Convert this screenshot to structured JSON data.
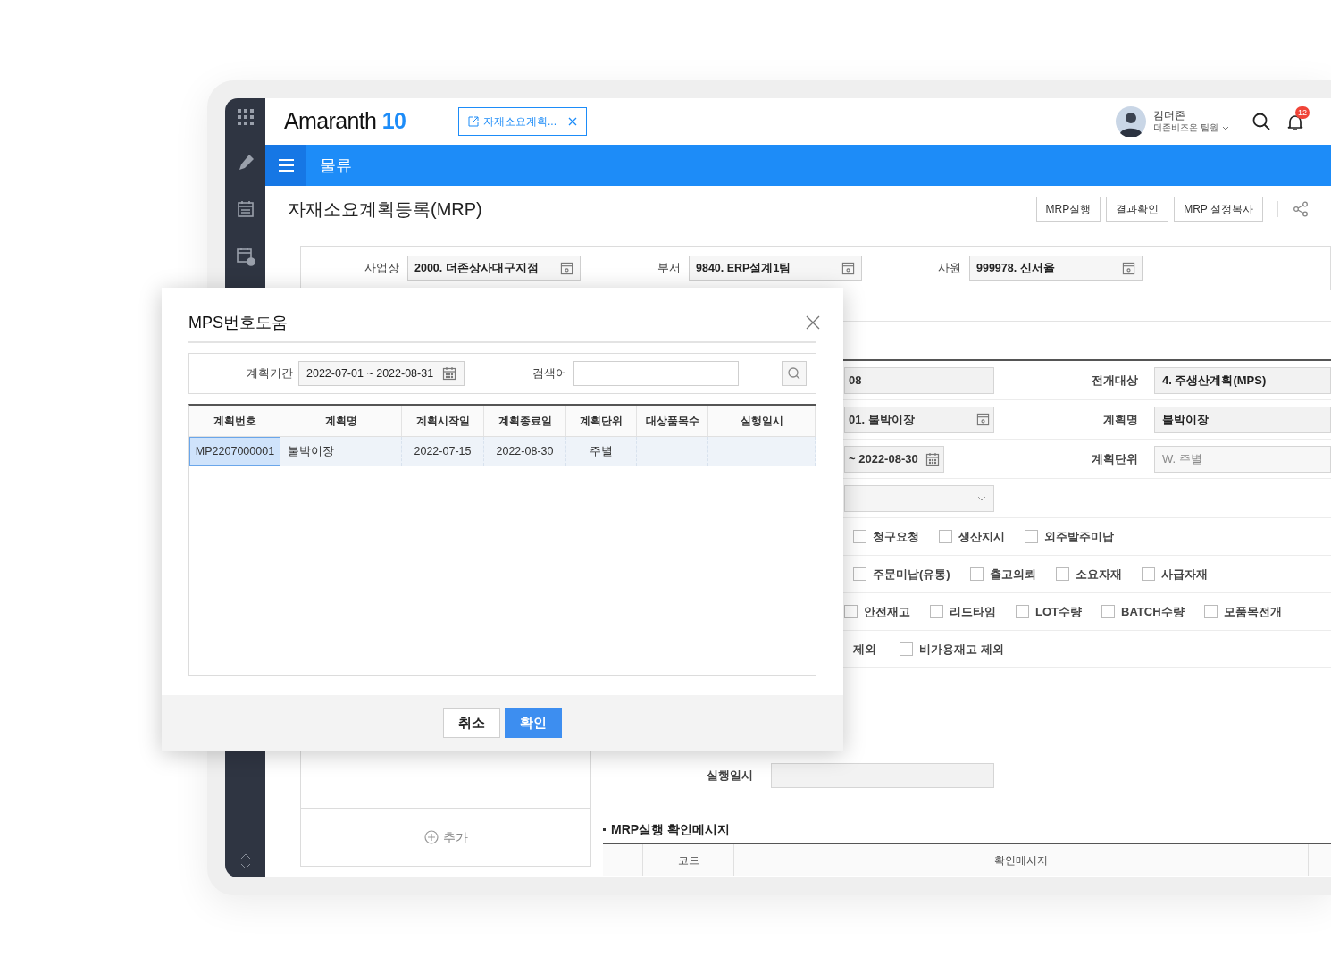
{
  "header": {
    "logo": {
      "name": "Amaranth",
      "version": "10"
    },
    "open_tab": "자재소요계획...",
    "user": {
      "name": "김더존",
      "role": "더존비즈온 팀원"
    },
    "notifications": "12"
  },
  "menu_bar": {
    "title": "물류"
  },
  "page": {
    "title": "자재소요계획등록(MRP)",
    "buttons": [
      "MRP실행",
      "결과확인",
      "MRP 설정복사"
    ]
  },
  "filters": [
    {
      "label": "사업장",
      "value": "2000. 더존상사대구지점"
    },
    {
      "label": "부서",
      "value": "9840. ERP설계1팀"
    },
    {
      "label": "사원",
      "value": "999978. 신서율"
    }
  ],
  "form_rows": [
    {
      "left": {
        "kind": "text",
        "value": "08"
      },
      "label": "전개대상",
      "value": "4. 주생산계획(MPS)",
      "disabled": false
    },
    {
      "left": {
        "kind": "lookup",
        "value": "01. 불박이장"
      },
      "label": "계획명",
      "value": "불박이장",
      "disabled": false
    },
    {
      "left": {
        "kind": "date",
        "value": "~ 2022-08-30"
      },
      "label": "계획단위",
      "value": "W. 주별",
      "disabled": true
    },
    {
      "left": {
        "kind": "select"
      }
    }
  ],
  "options": [
    [
      {
        "kind": "checkbox",
        "label": "청구요청",
        "checked": false
      },
      {
        "kind": "checkbox",
        "label": "생산지시",
        "checked": false
      },
      {
        "kind": "checkbox",
        "label": "외주발주미납",
        "checked": false
      }
    ],
    [
      {
        "kind": "checkbox",
        "label": "주문미납(유통)",
        "checked": false
      },
      {
        "kind": "checkbox",
        "label": "출고의뢰",
        "checked": false
      },
      {
        "kind": "checkbox",
        "label": "소요자재",
        "checked": false
      },
      {
        "kind": "checkbox",
        "label": "사급자재",
        "checked": false
      }
    ],
    [
      {
        "kind": "checkbox",
        "label": "안전재고",
        "checked": false
      },
      {
        "kind": "checkbox",
        "label": "리드타임",
        "checked": false
      },
      {
        "kind": "checkbox",
        "label": "LOT수량",
        "checked": false
      },
      {
        "kind": "checkbox",
        "label": "BATCH수량",
        "checked": false
      },
      {
        "kind": "checkbox",
        "label": "모품목전개",
        "checked": false
      }
    ],
    [
      {
        "kind": "label",
        "label": "제외"
      },
      {
        "kind": "checkbox",
        "label": "비가용재고 제외",
        "checked": false
      }
    ]
  ],
  "run_time": {
    "label": "실행일시"
  },
  "left_panel": {
    "add_button": "추가"
  },
  "messages": {
    "title": "MRP실행 확인메시지",
    "columns": [
      "코드",
      "확인메시지"
    ]
  },
  "dialog": {
    "title": "MPS번호도움",
    "period_label": "계획기간",
    "period": "2022-07-01 ~ 2022-08-31",
    "search_label": "검색어",
    "columns": [
      "계획번호",
      "계획명",
      "계획시작일",
      "계획종료일",
      "계획단위",
      "대상품목수",
      "실행일시"
    ],
    "rows": [
      {
        "selected": true,
        "cells": [
          "MP2207000001",
          "불박이장",
          "2022-07-15",
          "2022-08-30",
          "주별",
          "",
          ""
        ]
      }
    ],
    "buttons": [
      {
        "label": "취소",
        "kind": "secondary"
      },
      {
        "label": "확인",
        "kind": "primary"
      }
    ]
  }
}
